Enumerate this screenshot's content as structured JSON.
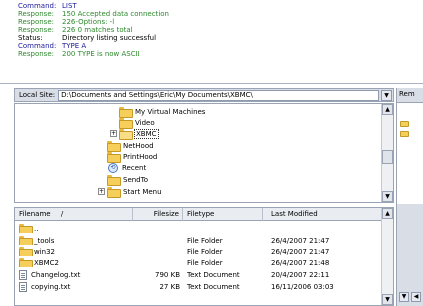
{
  "log": [
    {
      "key": "Command:",
      "value": "LIST",
      "kind": "cmd"
    },
    {
      "key": "Response:",
      "value": "150 Accepted data connection",
      "kind": "resp"
    },
    {
      "key": "Response:",
      "value": "226-Options: -l",
      "kind": "resp"
    },
    {
      "key": "Response:",
      "value": "226 0 matches total",
      "kind": "resp"
    },
    {
      "key": "Status:",
      "value": "Directory listing successful",
      "kind": "status"
    },
    {
      "key": "Command:",
      "value": "TYPE A",
      "kind": "cmd"
    },
    {
      "key": "Response:",
      "value": "200 TYPE is now ASCII",
      "kind": "resp"
    }
  ],
  "local_site": {
    "label": "Local Site:",
    "path": "D:\\Documents and Settings\\Eric\\My Documents\\XBMC\\"
  },
  "remote_site": {
    "label": "Rem"
  },
  "tree": [
    {
      "label": "My Virtual Machines",
      "icon": "folder-icon"
    },
    {
      "label": "Video",
      "icon": "folder-icon"
    },
    {
      "label": "XBMC",
      "icon": "folder-icon",
      "selected": true,
      "expander": "+"
    },
    {
      "label": "NetHood",
      "icon": "folder-icon"
    },
    {
      "label": "PrintHood",
      "icon": "folder-icon"
    },
    {
      "label": "Recent",
      "icon": "recent-icon"
    },
    {
      "label": "SendTo",
      "icon": "folder-icon"
    },
    {
      "label": "Start Menu",
      "icon": "folder-icon",
      "expander": "+"
    }
  ],
  "file_columns": {
    "name": "Filename",
    "sort_indicator": "/",
    "size": "Filesize",
    "type": "Filetype",
    "modified": "Last Modified"
  },
  "files": [
    {
      "name": "..",
      "size": "",
      "type": "",
      "modified": "",
      "icon": "folder-icon"
    },
    {
      "name": "_tools",
      "size": "",
      "type": "File Folder",
      "modified": "26/4/2007 21:47",
      "icon": "folder-icon"
    },
    {
      "name": "win32",
      "size": "",
      "type": "File Folder",
      "modified": "26/4/2007 21:47",
      "icon": "folder-icon"
    },
    {
      "name": "XBMC2",
      "size": "",
      "type": "File Folder",
      "modified": "26/4/2007 21:48",
      "icon": "folder-icon"
    },
    {
      "name": "Changelog.txt",
      "size": "790 KB",
      "type": "Text Document",
      "modified": "20/4/2007 22:11",
      "icon": "document-icon"
    },
    {
      "name": "copying.txt",
      "size": "27 KB",
      "type": "Text Document",
      "modified": "16/11/2006 03:03",
      "icon": "document-icon"
    }
  ],
  "icons": {
    "scroll_up": "▲",
    "scroll_down": "▼",
    "dropdown": "▼",
    "nav_left": "◀",
    "nav_right": "▶",
    "recent": "⟲"
  },
  "colors": {
    "command": "#1a1a9a",
    "response": "#2d8a2d",
    "status": "#000000",
    "folder": "#f5cf5a"
  }
}
